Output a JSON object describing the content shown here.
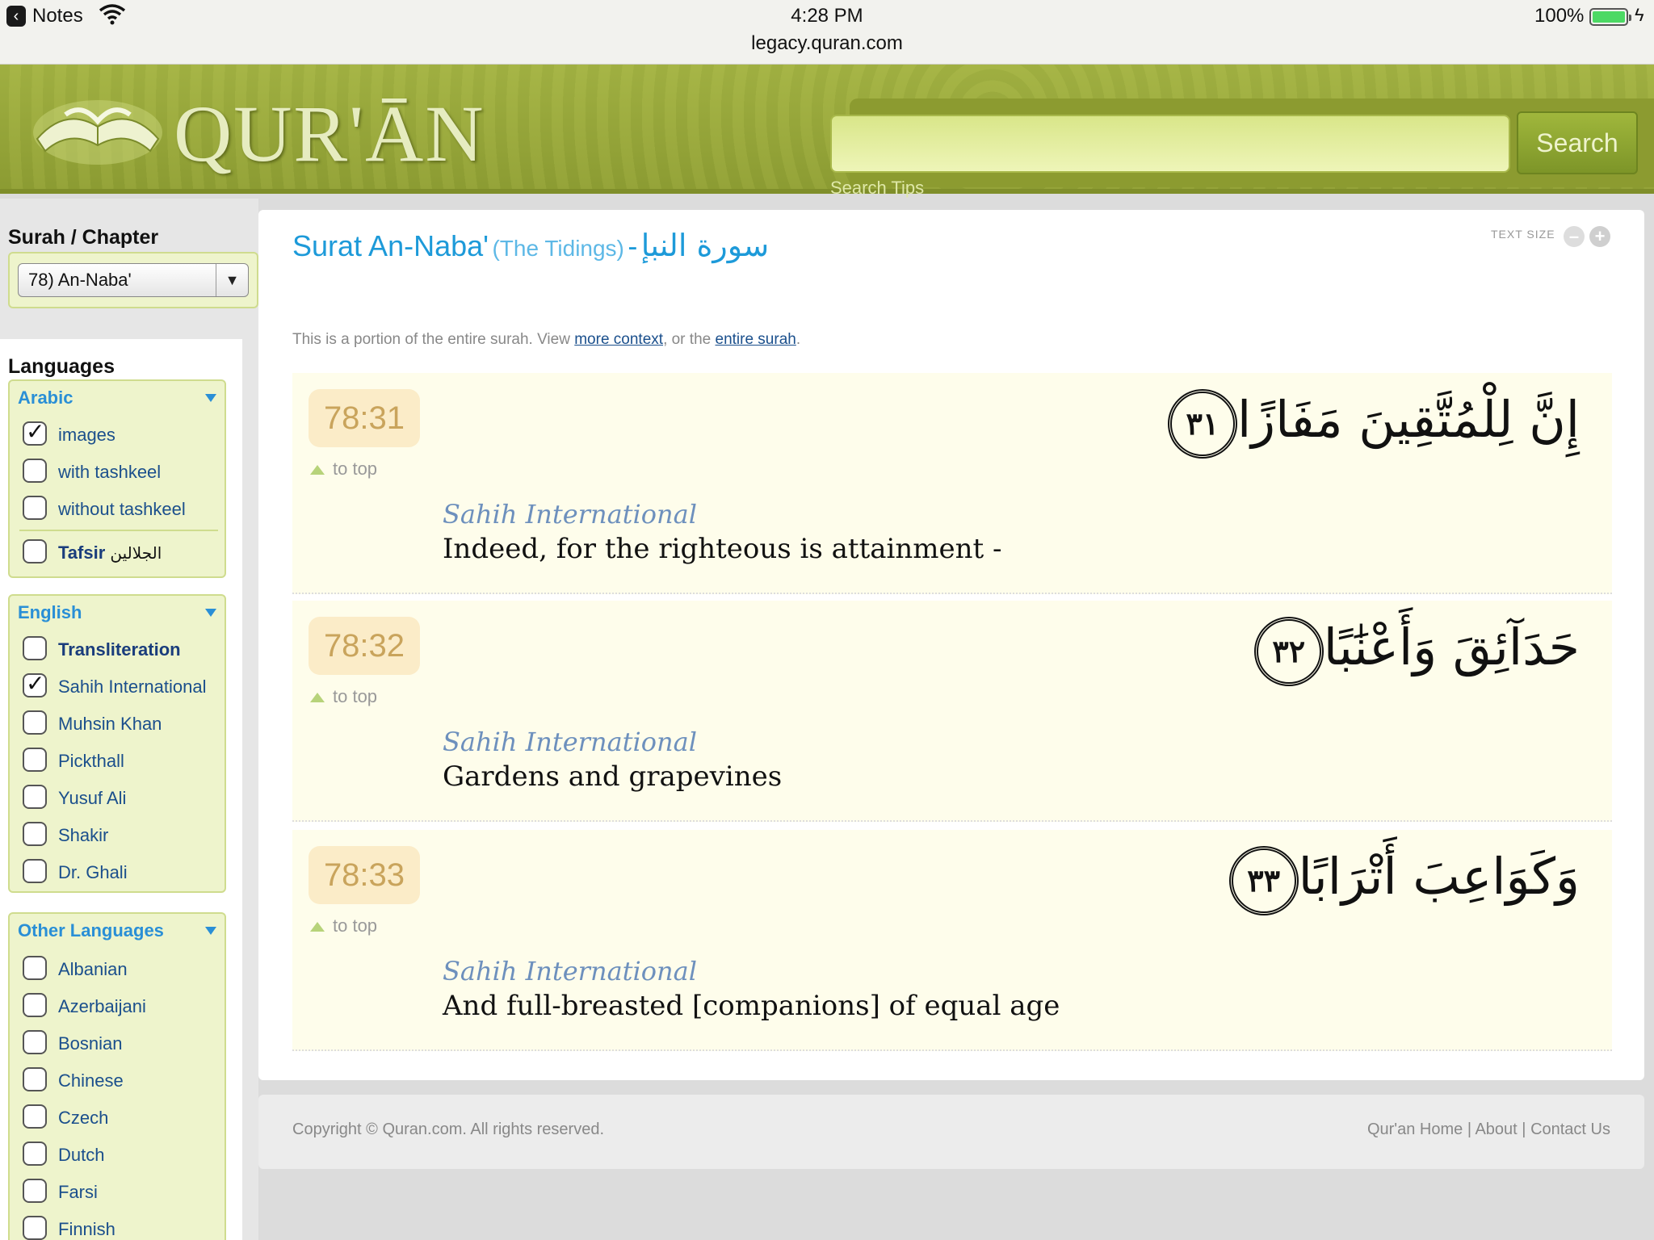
{
  "status_bar": {
    "back_app": "Notes",
    "time": "4:28 PM",
    "url": "legacy.quran.com",
    "battery": "100%"
  },
  "header": {
    "logo_text": "QUR'ĀN",
    "search_placeholder": "",
    "search_button": "Search",
    "search_tips": "Search Tips"
  },
  "sidebar": {
    "chapter_title": "Surah / Chapter",
    "chapter_selected": "78) An-Naba'",
    "languages_title": "Languages",
    "groups": {
      "arabic": {
        "title": "Arabic",
        "options": [
          {
            "label": "images",
            "checked": true
          },
          {
            "label": "with tashkeel",
            "checked": false
          },
          {
            "label": "without tashkeel",
            "checked": false
          }
        ],
        "tafsir": {
          "label": "Tafsir",
          "arabic": "الجلالين",
          "checked": false
        }
      },
      "english": {
        "title": "English",
        "options": [
          {
            "label": "Transliteration",
            "checked": false
          },
          {
            "label": "Sahih International",
            "checked": true
          },
          {
            "label": "Muhsin Khan",
            "checked": false
          },
          {
            "label": "Pickthall",
            "checked": false
          },
          {
            "label": "Yusuf Ali",
            "checked": false
          },
          {
            "label": "Shakir",
            "checked": false
          },
          {
            "label": "Dr. Ghali",
            "checked": false
          }
        ]
      },
      "other": {
        "title": "Other Languages",
        "options": [
          {
            "label": "Albanian",
            "checked": false
          },
          {
            "label": "Azerbaijani",
            "checked": false
          },
          {
            "label": "Bosnian",
            "checked": false
          },
          {
            "label": "Chinese",
            "checked": false
          },
          {
            "label": "Czech",
            "checked": false
          },
          {
            "label": "Dutch",
            "checked": false
          },
          {
            "label": "Farsi",
            "checked": false
          },
          {
            "label": "Finnish",
            "checked": false
          }
        ]
      }
    }
  },
  "main": {
    "surah_name": "Surat An-Naba'",
    "surah_meaning": "(The Tidings)",
    "separator": "-",
    "surah_arabic": "سورة النبإ",
    "text_size_label": "TEXT SIZE",
    "text_size_minus": "–",
    "text_size_plus": "+",
    "portion_note_prefix": "This is a portion of the entire surah. View",
    "more_context": "more context",
    "portion_note_mid": ", or the",
    "entire_surah": "entire surah",
    "portion_note_end": ".",
    "to_top": "to top",
    "verses": [
      {
        "ref": "78:31",
        "arabic": "إِنَّ لِلْمُتَّقِينَ مَفَازًا",
        "ayah_no": "٣١",
        "translator": "Sahih International",
        "translation": "Indeed, for the righteous is attainment -"
      },
      {
        "ref": "78:32",
        "arabic": "حَدَآئِقَ وَأَعْنَٰبًا",
        "ayah_no": "٣٢",
        "translator": "Sahih International",
        "translation": "Gardens and grapevines"
      },
      {
        "ref": "78:33",
        "arabic": "وَكَوَاعِبَ أَتْرَابًا",
        "ayah_no": "٣٣",
        "translator": "Sahih International",
        "translation": "And full-breasted [companions] of equal age"
      }
    ]
  },
  "footer": {
    "copyright": "Copyright © Quran.com. All rights reserved.",
    "links": [
      "Qur'an Home",
      "About",
      "Contact Us"
    ],
    "link_separator": "|"
  },
  "colors": {
    "header_green": "#8f9f34",
    "link_blue": "#1d9ad9",
    "verse_bg": "#fefdeb",
    "verse_badge": "#fbecc8",
    "sidebar_group_bg": "#eef4cc"
  }
}
